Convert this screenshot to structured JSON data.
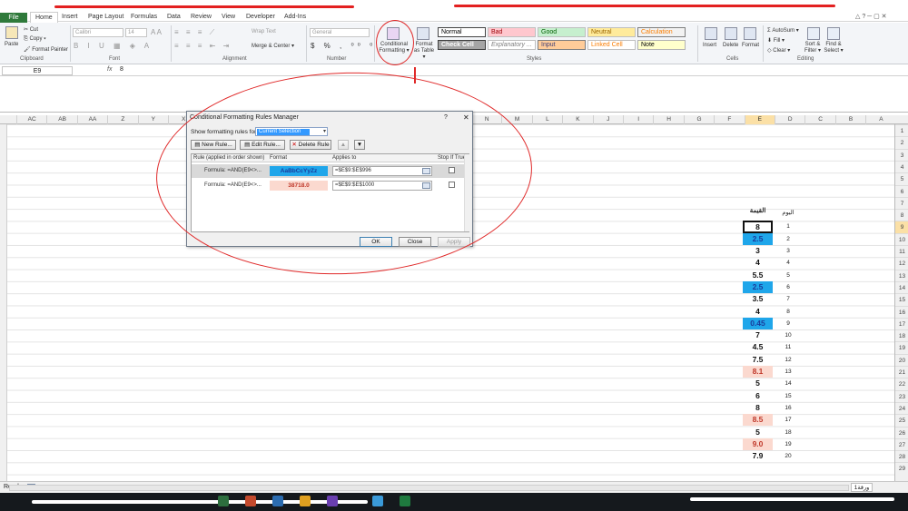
{
  "tabs": [
    "File",
    "Home",
    "Insert",
    "Page Layout",
    "Formulas",
    "Data",
    "Review",
    "View",
    "Developer",
    "Add-Ins"
  ],
  "clipboard": {
    "paste": "Paste",
    "cut": "Cut",
    "copy": "Copy ▾",
    "format_painter": "Format Painter",
    "label": "Clipboard"
  },
  "font": {
    "name": "Calibri",
    "size": "14",
    "label": "Font"
  },
  "alignment": {
    "wrap": "Wrap Text",
    "merge": "Merge & Center ▾",
    "label": "Alignment"
  },
  "number": {
    "format": "General",
    "label": "Number"
  },
  "styles": {
    "conditional": "Conditional Formatting ▾",
    "format_table": "Format as Table ▾",
    "label": "Styles",
    "cells": [
      {
        "name": "Normal",
        "bg": "#ffffff",
        "color": "#000000",
        "border": "#444444"
      },
      {
        "name": "Bad",
        "bg": "#ffc7ce",
        "color": "#9c0006",
        "border": "#bfbfbf"
      },
      {
        "name": "Good",
        "bg": "#c6efce",
        "color": "#006100",
        "border": "#bfbfbf"
      },
      {
        "name": "Neutral",
        "bg": "#ffeb9c",
        "color": "#9c6500",
        "border": "#bfbfbf"
      },
      {
        "name": "Calculation",
        "bg": "#f2f2f2",
        "color": "#fa7d00",
        "border": "#7f7f7f"
      },
      {
        "name": "Check Cell",
        "bg": "#a5a5a5",
        "color": "#ffffff",
        "border": "#3f3f3f"
      },
      {
        "name": "Explanatory ...",
        "bg": "#ffffff",
        "color": "#7f7f7f",
        "border": "#bfbfbf"
      },
      {
        "name": "Input",
        "bg": "#ffcc99",
        "color": "#3f3f76",
        "border": "#7f7f7f"
      },
      {
        "name": "Linked Cell",
        "bg": "#ffffff",
        "color": "#fa7d00",
        "border": "#bfbfbf"
      },
      {
        "name": "Note",
        "bg": "#ffffcc",
        "color": "#000000",
        "border": "#b2b2b2"
      }
    ]
  },
  "cells_group": {
    "insert": "Insert",
    "delete": "Delete",
    "format": "Format",
    "label": "Cells"
  },
  "editing": {
    "autosum": "AutoSum ▾",
    "fill": "Fill ▾",
    "clear": "Clear ▾",
    "sort": "Sort & Filter ▾",
    "find": "Find & Select ▾",
    "label": "Editing"
  },
  "namebox": "E9",
  "fx": "fx",
  "formula": "8",
  "columns": [
    "AC",
    "AB",
    "AA",
    "Z",
    "Y",
    "X",
    "W",
    "V",
    "U",
    "T",
    "S",
    "R",
    "Q",
    "P",
    "O",
    "N",
    "M",
    "L",
    "K",
    "J",
    "I",
    "H",
    "G",
    "F",
    "E",
    "D",
    "C",
    "B",
    "A"
  ],
  "rows": [
    "1",
    "2",
    "3",
    "4",
    "5",
    "6",
    "7",
    "8",
    "9",
    "10",
    "11",
    "12",
    "13",
    "14",
    "15",
    "16",
    "17",
    "18",
    "19",
    "20",
    "21",
    "22",
    "23",
    "24",
    "25",
    "26",
    "27",
    "28",
    "29"
  ],
  "sheet": {
    "header_e": "القيمة",
    "header_d": "اليوم",
    "values": [
      {
        "v": "8",
        "d": "1",
        "style": "selected"
      },
      {
        "v": "2.5",
        "d": "2",
        "style": "blue"
      },
      {
        "v": "3",
        "d": "3",
        "style": ""
      },
      {
        "v": "4",
        "d": "4",
        "style": ""
      },
      {
        "v": "5.5",
        "d": "5",
        "style": ""
      },
      {
        "v": "2.5",
        "d": "6",
        "style": "blue"
      },
      {
        "v": "3.5",
        "d": "7",
        "style": ""
      },
      {
        "v": "4",
        "d": "8",
        "style": ""
      },
      {
        "v": "0.45",
        "d": "9",
        "style": "blue"
      },
      {
        "v": "7",
        "d": "10",
        "style": ""
      },
      {
        "v": "4.5",
        "d": "11",
        "style": ""
      },
      {
        "v": "7.5",
        "d": "12",
        "style": ""
      },
      {
        "v": "8.1",
        "d": "13",
        "style": "red"
      },
      {
        "v": "5",
        "d": "14",
        "style": ""
      },
      {
        "v": "6",
        "d": "15",
        "style": ""
      },
      {
        "v": "8",
        "d": "16",
        "style": ""
      },
      {
        "v": "8.5",
        "d": "17",
        "style": "red"
      },
      {
        "v": "5",
        "d": "18",
        "style": ""
      },
      {
        "v": "9.0",
        "d": "19",
        "style": "red"
      },
      {
        "v": "7.9",
        "d": "20",
        "style": ""
      }
    ]
  },
  "dialog": {
    "title": "Conditional Formatting Rules Manager",
    "help": "?",
    "close": "✕",
    "show_label": "Show formatting rules for:",
    "show_value": "Current Selection",
    "new_rule": "New Rule...",
    "edit_rule": "Edit Rule...",
    "delete_rule": "Delete Rule",
    "col_rule": "Rule (applied in order shown)",
    "col_format": "Format",
    "col_applies": "Applies to",
    "col_stop": "Stop If True",
    "rules": [
      {
        "formula": "Formula: =AND(E9<>...",
        "preview": "AaBbCcYyZz",
        "applies": "=$E$9:$E$996",
        "bg": "#1fa6ea",
        "color": "#1a3c9c"
      },
      {
        "formula": "Formula: =AND(E9<>...",
        "preview": "38718.0",
        "applies": "=$E$9:$E$1000",
        "bg": "#fbd9cf",
        "color": "#c0392b"
      }
    ],
    "ok": "OK",
    "close_btn": "Close",
    "apply": "Apply"
  },
  "status": {
    "ready": "Ready",
    "sheet_tab": "ورقة1"
  }
}
